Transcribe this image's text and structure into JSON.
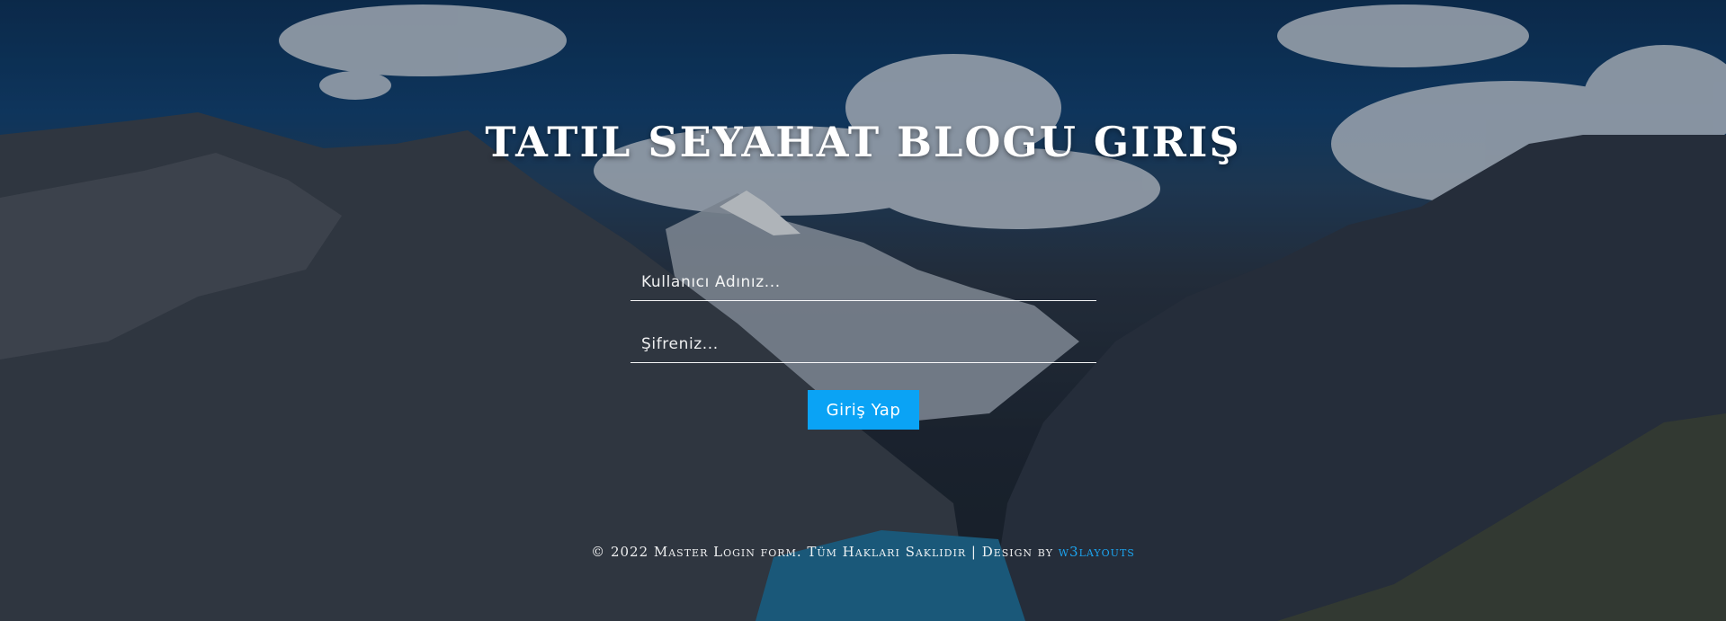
{
  "page": {
    "title": "TATIL SEYAHAT BLOGU GIRIŞ"
  },
  "form": {
    "username_placeholder": "Kullanıcı Adınız...",
    "password_placeholder": "Şifreniz...",
    "submit_label": "Giriş Yap"
  },
  "footer": {
    "copyright_text": "© 2022 Master Login form. Tüm Hakları Saklıdır | Design by",
    "brand_link": "w3layouts"
  },
  "colors": {
    "accent_button": "#0aa3f5",
    "footer_link": "#1ca6f2",
    "text": "#ffffff"
  }
}
